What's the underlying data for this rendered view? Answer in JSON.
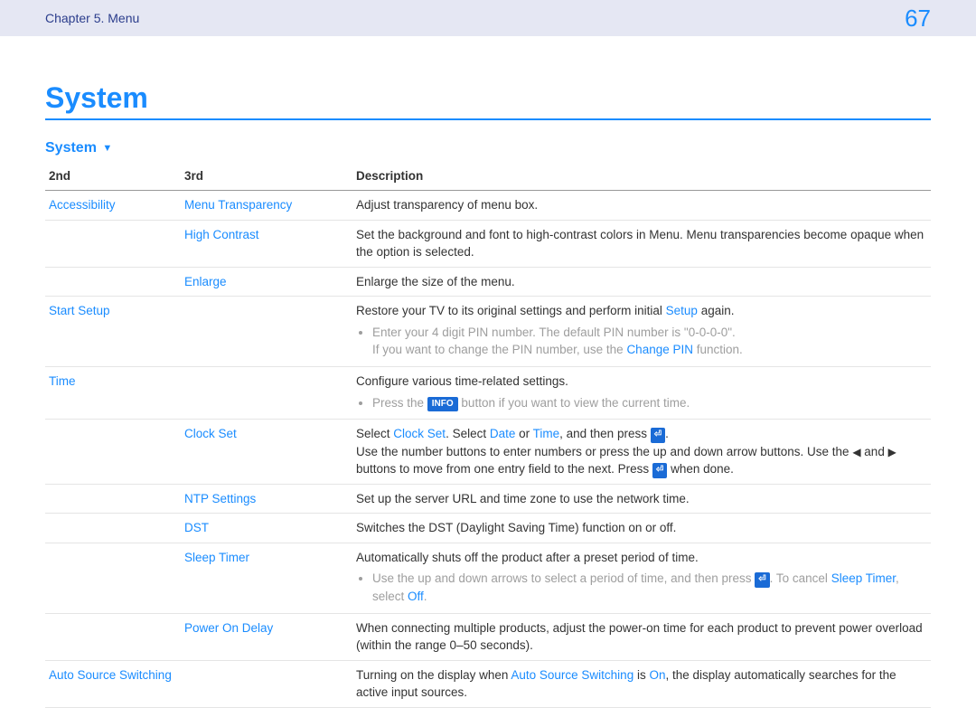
{
  "header": {
    "chapter": "Chapter 5. Menu",
    "page_number": "67"
  },
  "title": "System",
  "section_title": "System",
  "columns": {
    "c2nd": "2nd",
    "c3rd": "3rd",
    "cdesc": "Description"
  },
  "rows": {
    "r0_2nd": "Accessibility",
    "r0_3rd": "Menu Transparency",
    "r0_desc": "Adjust transparency of menu box.",
    "r1_3rd": "High Contrast",
    "r1_desc": "Set the background and font to high-contrast colors in Menu. Menu transparencies become opaque when the option is selected.",
    "r2_3rd": "Enlarge",
    "r2_desc": "Enlarge the size of the menu.",
    "r3_2nd": "Start Setup",
    "r3_desc_a": "Restore your TV to its original settings and perform initial ",
    "r3_desc_setup": "Setup",
    "r3_desc_b": " again.",
    "r3_b1": "Enter your 4 digit PIN number. The default PIN number is \"0-0-0-0\".",
    "r3_b2_a": "If you want to change the PIN number, use the ",
    "r3_b2_link": "Change PIN",
    "r3_b2_b": " function.",
    "r4_2nd": "Time",
    "r4_desc": "Configure various time-related settings.",
    "r4_b1_a": "Press the ",
    "r4_b1_info": "INFO",
    "r4_b1_b": " button if you want to view the current time.",
    "r5_3rd": "Clock Set",
    "r5_a": "Select ",
    "r5_clockset": "Clock Set",
    "r5_b": ". Select ",
    "r5_date": "Date",
    "r5_c": " or ",
    "r5_time": "Time",
    "r5_d": ", and then press ",
    "r5_e": ".",
    "r5_l2_a": "Use the number buttons to enter numbers or press the up and down arrow buttons. Use the ",
    "r5_l2_b": " and ",
    "r5_l2_c": " buttons to move from one entry field to the next. Press ",
    "r5_l2_d": " when done.",
    "r6_3rd": "NTP Settings",
    "r6_desc": "Set up the server URL and time zone to use the network time.",
    "r7_3rd": "DST",
    "r7_desc": "Switches the DST (Daylight Saving Time) function on or off.",
    "r8_3rd": "Sleep Timer",
    "r8_desc": "Automatically shuts off the product after a preset period of time.",
    "r8_b1_a": "Use the up and down arrows to select a period of time, and then press ",
    "r8_b1_b": ". To cancel ",
    "r8_b1_sleep": "Sleep Timer",
    "r8_b1_c": ", select ",
    "r8_b1_off": "Off",
    "r8_b1_d": ".",
    "r9_3rd": "Power On Delay",
    "r9_desc": "When connecting multiple products, adjust the power-on time for each product to prevent power overload (within the range 0–50 seconds).",
    "r10_2nd": "Auto Source Switching",
    "r10_a": "Turning on the display when ",
    "r10_link": "Auto Source Switching",
    "r10_b": " is ",
    "r10_on": "On",
    "r10_c": ", the display automatically searches for the active input sources."
  }
}
